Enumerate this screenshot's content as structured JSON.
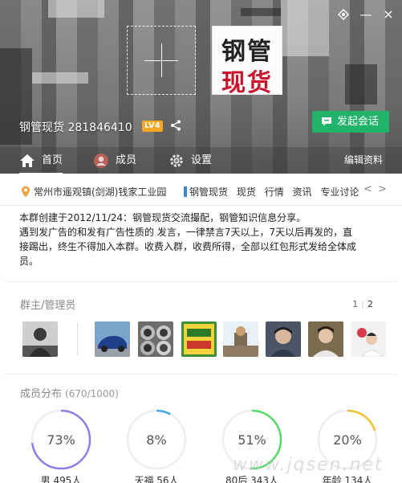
{
  "window": {
    "buttons": {
      "skin_icon": "skin-icon",
      "minimize": "—",
      "close": "×"
    }
  },
  "header": {
    "avatar_text_line1": "钢管",
    "avatar_text_line2": "现货",
    "group_title": "钢管现货 281846410",
    "level": "LV4",
    "start_chat_label": "发起会话",
    "colors": {
      "start_chat": "#22b36a",
      "level_badge": "#f5a623"
    }
  },
  "nav": {
    "tabs": [
      {
        "label": "首页",
        "icon": "home-icon",
        "active": true
      },
      {
        "label": "成员",
        "icon": "members-icon",
        "active": false
      },
      {
        "label": "设置",
        "icon": "settings-icon",
        "active": false
      }
    ],
    "edit_label": "编辑资料"
  },
  "tags": {
    "location": "常州市遥观镇(剑湖)钱家工业园",
    "items": [
      "钢管现货",
      "现货",
      "行情",
      "资讯",
      "专业讨论"
    ],
    "prev": "<",
    "next": ">"
  },
  "intro": {
    "line1": "本群创建于2012/11/24：钢管现货交流撮配，钢管知识信息分享。",
    "line2": "遇到发广告的和发有广告性质的 发言，一律禁言7天以上，7天以后再发的，直",
    "line3": "接踢出，终生不得加入本群。收费入群，收费所得，全部以红包形式发给全体成",
    "line4": "员。"
  },
  "admins": {
    "title": "群主/管理员",
    "page_prev": "1",
    "page_cur": "2"
  },
  "distribution": {
    "title": "成员分布",
    "count": "(670/1000)",
    "rings": [
      {
        "pct": "73%",
        "value": 0.73,
        "color": "#8f7fe6",
        "label": "男 495人"
      },
      {
        "pct": "8%",
        "value": 0.08,
        "color": "#42a9e0",
        "label": "天福 56人"
      },
      {
        "pct": "51%",
        "value": 0.51,
        "color": "#55d96b",
        "label": "80后 343人"
      },
      {
        "pct": "20%",
        "value": 0.2,
        "color": "#f1c232",
        "label": "年龄 134人"
      }
    ]
  },
  "watermark": "www.jqsen.net"
}
